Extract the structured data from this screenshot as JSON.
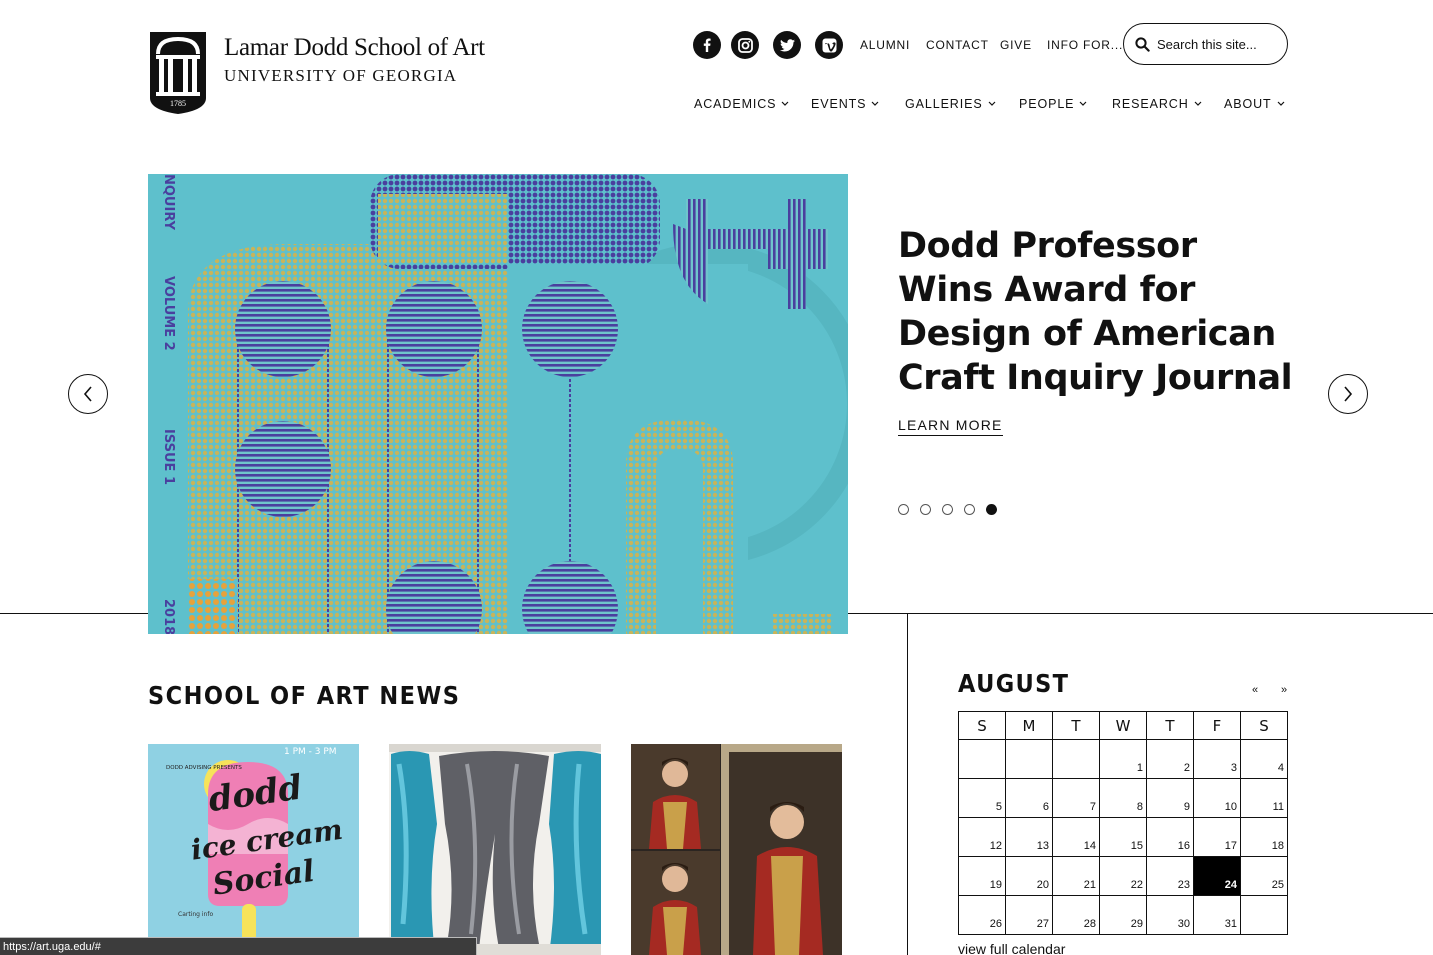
{
  "header": {
    "brand_name": "Lamar Dodd School of Art",
    "brand_sub": "UNIVERSITY OF GEORGIA",
    "logo_year": "1785",
    "social": [
      "facebook-icon",
      "instagram-icon",
      "twitter-icon",
      "vimeo-icon"
    ],
    "utility_links": [
      "ALUMNI",
      "CONTACT",
      "GIVE",
      "INFO FOR..."
    ],
    "search_placeholder": "Search this site...",
    "main_nav": [
      "ACADEMICS",
      "EVENTS",
      "GALLERIES",
      "PEOPLE",
      "RESEARCH",
      "ABOUT"
    ]
  },
  "hero": {
    "title": "Dodd Professor Wins Award for Design of American Craft Inquiry Journal",
    "link": "LEARN MORE",
    "slides_total": 5,
    "active_slide": 5,
    "image_text": [
      "NQUIRY",
      "VOLUME 2",
      "ISSUE 1",
      "2018"
    ]
  },
  "news": {
    "heading": "SCHOOL OF ART NEWS",
    "card1_text": {
      "presents": "DODD ADVISING PRESENTS",
      "time": "1 PM - 3 PM",
      "title_dodd": "dodd",
      "title_icecream": "ice cream",
      "title_social": "Social",
      "footer": "Carting info"
    }
  },
  "calendar": {
    "month": "AUGUST",
    "prev": "«",
    "next": "»",
    "weekdays": [
      "S",
      "M",
      "T",
      "W",
      "T",
      "F",
      "S"
    ],
    "weeks": [
      [
        "",
        "",
        "",
        "1",
        "2",
        "3",
        "4"
      ],
      [
        "5",
        "6",
        "7",
        "8",
        "9",
        "10",
        "11"
      ],
      [
        "12",
        "13",
        "14",
        "15",
        "16",
        "17",
        "18"
      ],
      [
        "19",
        "20",
        "21",
        "22",
        "23",
        "24",
        "25"
      ],
      [
        "26",
        "27",
        "28",
        "29",
        "30",
        "31",
        ""
      ]
    ],
    "today": "24",
    "link": "view full calendar"
  },
  "status_url": "https://art.uga.edu/#",
  "colors": {
    "hero_bg": "#5ec0cc",
    "hero_purple": "#4a3f9e",
    "hero_mustard": "#c8b45a",
    "text": "#111111"
  }
}
